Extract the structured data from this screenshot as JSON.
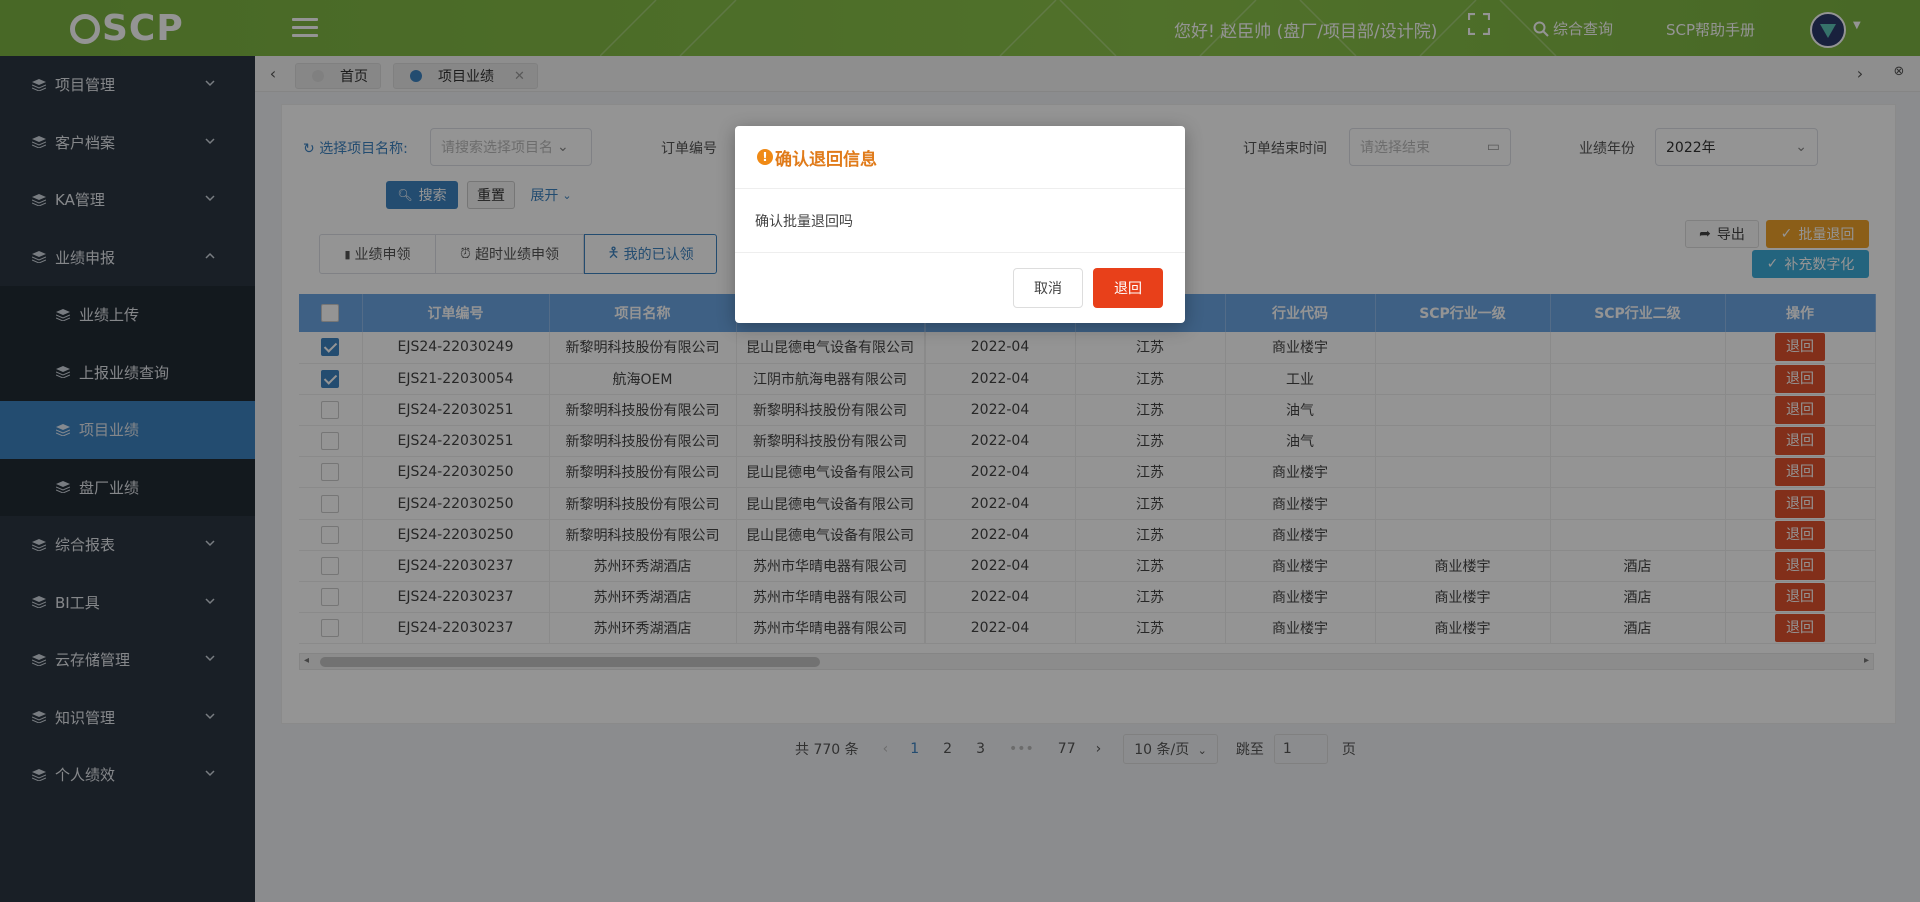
{
  "header": {
    "logo": "SCP",
    "greeting": "您好! 赵臣帅 (盘厂/项目部/设计院)",
    "search_label": "综合查询",
    "help_label": "SCP帮助手册"
  },
  "sidebar": {
    "items": [
      {
        "label": "项目管理"
      },
      {
        "label": "客户档案"
      },
      {
        "label": "KA管理"
      },
      {
        "label": "业绩申报"
      },
      {
        "label": "综合报表"
      },
      {
        "label": "BI工具"
      },
      {
        "label": "云存储管理"
      },
      {
        "label": "知识管理"
      },
      {
        "label": "个人绩效"
      }
    ],
    "sub_items": [
      {
        "label": "业绩上传"
      },
      {
        "label": "上报业绩查询"
      },
      {
        "label": "项目业绩"
      },
      {
        "label": "盘厂业绩"
      }
    ]
  },
  "tabs": [
    {
      "label": "首页"
    },
    {
      "label": "项目业绩"
    }
  ],
  "filters": {
    "project_label": "选择项目名称:",
    "project_placeholder": "请搜索选择项目名",
    "order_label": "订单编号",
    "order_end_label": "订单结束时间",
    "order_end_placeholder": "请选择结束",
    "year_label": "业绩年份",
    "year_value": "2022年",
    "search_button": "搜索",
    "reset_button": "重置",
    "expand_button": "展开"
  },
  "segments": [
    "业绩申领",
    "超时业绩申领",
    "我的已认领"
  ],
  "actions": {
    "export": "导出",
    "batch_return": "批量退回",
    "supplement": "补充数字化"
  },
  "table": {
    "columns": [
      "订单编号",
      "项目名称",
      "",
      "",
      "",
      "行业代码",
      "SCP行业一级",
      "SCP行业二级",
      "操作"
    ],
    "rows": [
      {
        "checked": true,
        "order": "EJS24-22030249",
        "project": "新黎明科技股份有限公司",
        "customer": "昆山昆德电气设备有限公司",
        "month": "2022-04",
        "province": "江苏",
        "industry": "商业楼宇",
        "l1": "",
        "l2": "",
        "op": "退回"
      },
      {
        "checked": true,
        "order": "EJS21-22030054",
        "project": "航海OEM",
        "customer": "江阴市航海电器有限公司",
        "month": "2022-04",
        "province": "江苏",
        "industry": "工业",
        "l1": "",
        "l2": "",
        "op": "退回"
      },
      {
        "checked": false,
        "order": "EJS24-22030251",
        "project": "新黎明科技股份有限公司",
        "customer": "新黎明科技股份有限公司",
        "month": "2022-04",
        "province": "江苏",
        "industry": "油气",
        "l1": "",
        "l2": "",
        "op": "退回"
      },
      {
        "checked": false,
        "order": "EJS24-22030251",
        "project": "新黎明科技股份有限公司",
        "customer": "新黎明科技股份有限公司",
        "month": "2022-04",
        "province": "江苏",
        "industry": "油气",
        "l1": "",
        "l2": "",
        "op": "退回"
      },
      {
        "checked": false,
        "order": "EJS24-22030250",
        "project": "新黎明科技股份有限公司",
        "customer": "昆山昆德电气设备有限公司",
        "month": "2022-04",
        "province": "江苏",
        "industry": "商业楼宇",
        "l1": "",
        "l2": "",
        "op": "退回"
      },
      {
        "checked": false,
        "order": "EJS24-22030250",
        "project": "新黎明科技股份有限公司",
        "customer": "昆山昆德电气设备有限公司",
        "month": "2022-04",
        "province": "江苏",
        "industry": "商业楼宇",
        "l1": "",
        "l2": "",
        "op": "退回"
      },
      {
        "checked": false,
        "order": "EJS24-22030250",
        "project": "新黎明科技股份有限公司",
        "customer": "昆山昆德电气设备有限公司",
        "month": "2022-04",
        "province": "江苏",
        "industry": "商业楼宇",
        "l1": "",
        "l2": "",
        "op": "退回"
      },
      {
        "checked": false,
        "order": "EJS24-22030237",
        "project": "苏州环秀湖酒店",
        "customer": "苏州市华晴电器有限公司",
        "month": "2022-04",
        "province": "江苏",
        "industry": "商业楼宇",
        "l1": "商业楼宇",
        "l2": "酒店",
        "op": "退回"
      },
      {
        "checked": false,
        "order": "EJS24-22030237",
        "project": "苏州环秀湖酒店",
        "customer": "苏州市华晴电器有限公司",
        "month": "2022-04",
        "province": "江苏",
        "industry": "商业楼宇",
        "l1": "商业楼宇",
        "l2": "酒店",
        "op": "退回"
      },
      {
        "checked": false,
        "order": "EJS24-22030237",
        "project": "苏州环秀湖酒店",
        "customer": "苏州市华晴电器有限公司",
        "month": "2022-04",
        "province": "江苏",
        "industry": "商业楼宇",
        "l1": "商业楼宇",
        "l2": "酒店",
        "op": "退回"
      }
    ]
  },
  "pagination": {
    "total": "共 770 条",
    "pages": [
      "1",
      "2",
      "3",
      "•••",
      "77"
    ],
    "current": "1",
    "page_size": "10 条/页",
    "jump_label": "跳至",
    "jump_value": "1",
    "page_unit": "页"
  },
  "modal": {
    "title": "确认退回信息",
    "body": "确认批量退回吗",
    "cancel": "取消",
    "confirm": "退回"
  },
  "colors": {
    "topbar": "#8bc34a",
    "sidebar": "#2b3642",
    "active_nav": "#3d83c2",
    "table_header": "#6ca6e4",
    "return_button": "#e0522d",
    "confirm_button": "#e8401a"
  }
}
